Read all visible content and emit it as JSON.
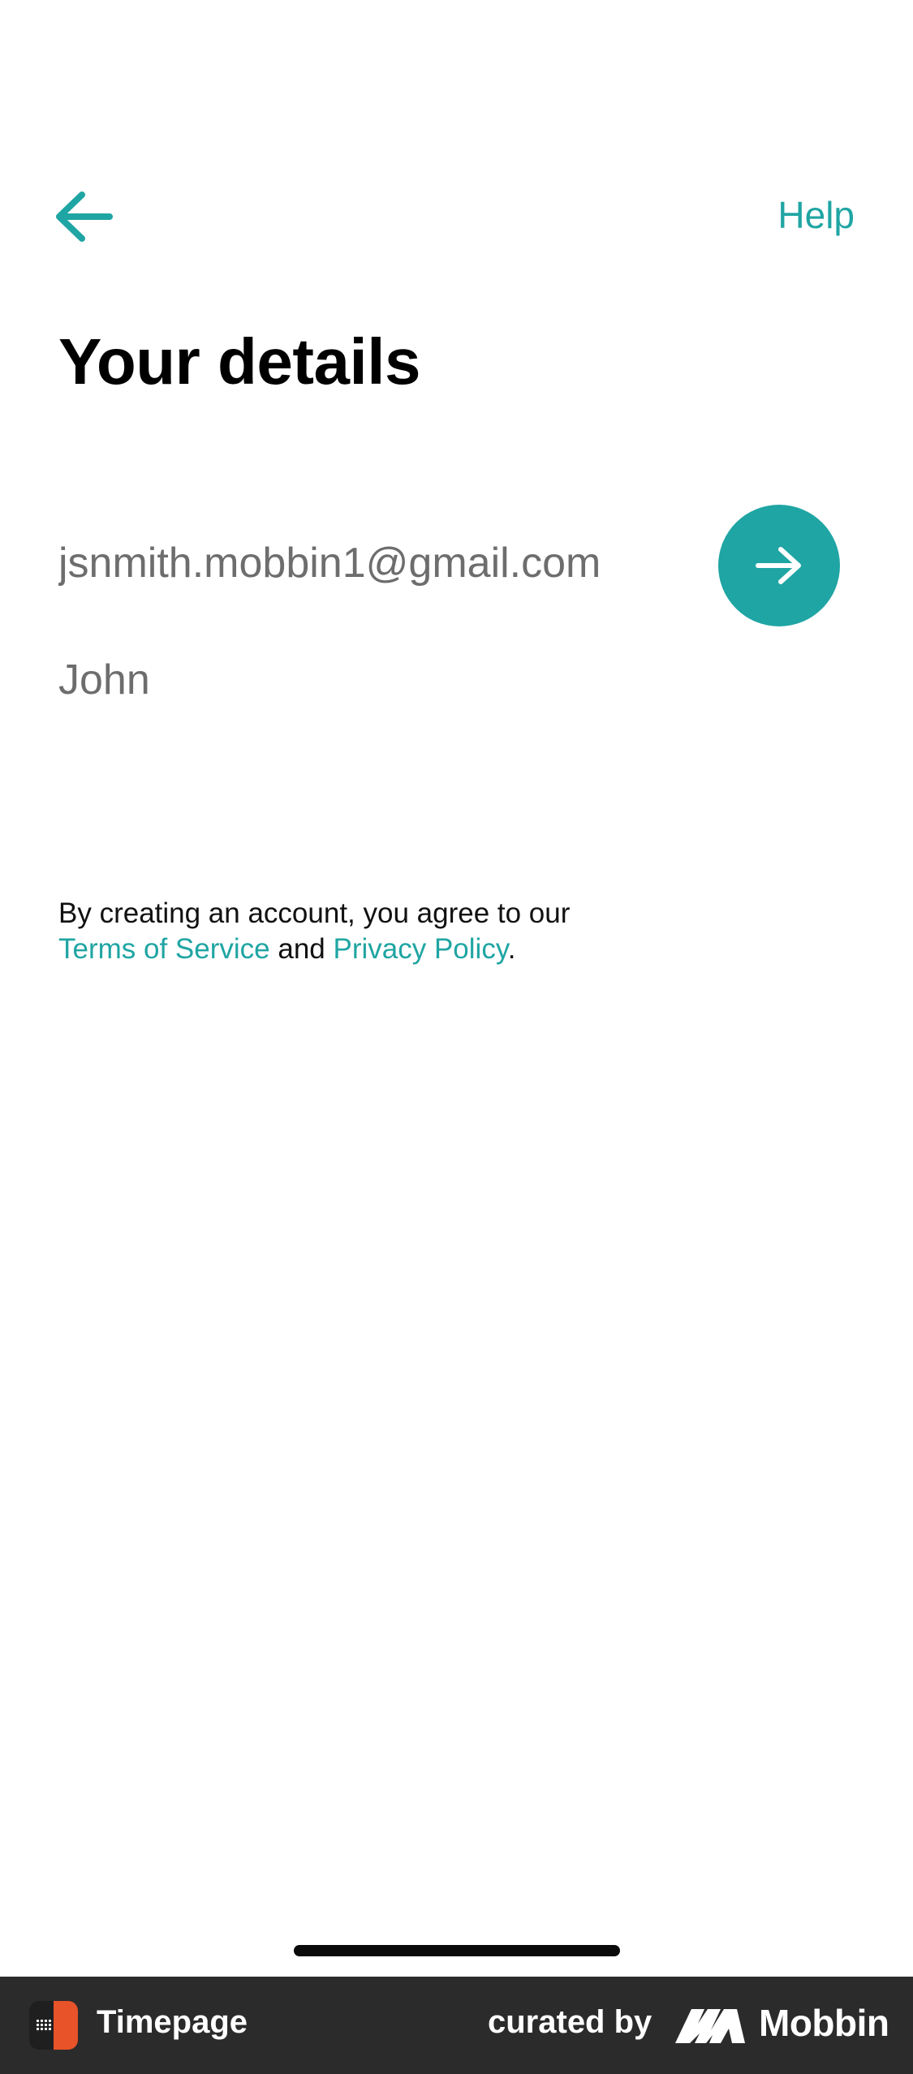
{
  "header": {
    "back_icon": "arrow-left-icon",
    "help_label": "Help"
  },
  "main": {
    "title": "Your details",
    "email_value": "jsnmith.mobbin1@gmail.com",
    "name_value": "John",
    "next_icon": "arrow-right-icon"
  },
  "terms": {
    "prefix": "By creating an account, you agree to our",
    "terms_link": "Terms of Service",
    "conjunction": "and",
    "privacy_link": "Privacy Policy",
    "suffix": "."
  },
  "footer": {
    "app_name": "Timepage",
    "curated_label": "curated by",
    "brand_name": "Mobbin"
  },
  "colors": {
    "accent": "#1fa5a3",
    "footer_bg": "#2b2b2b",
    "app_logo_orange": "#e8532a"
  }
}
